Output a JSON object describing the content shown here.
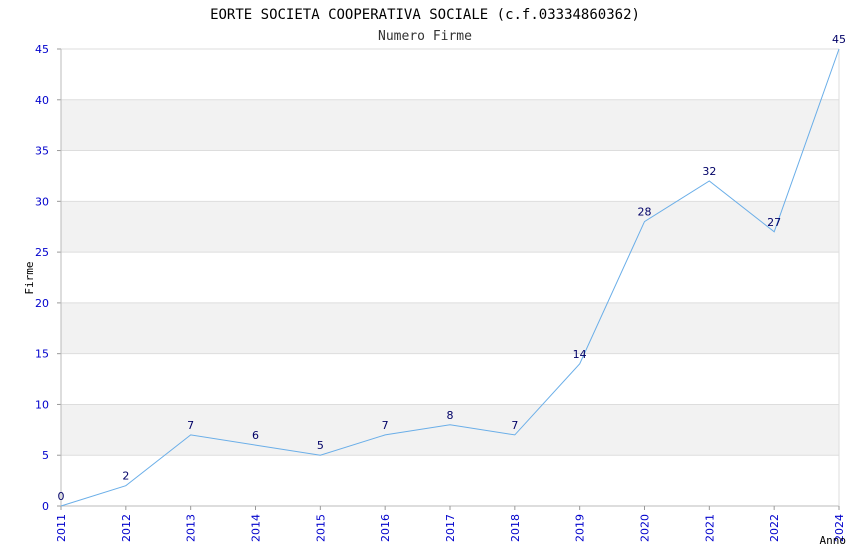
{
  "chart_data": {
    "type": "line",
    "title": "EORTE SOCIETA COOPERATIVA SOCIALE (c.f.03334860362)",
    "subtitle": "Numero Firme",
    "xlabel": "Anno",
    "ylabel": "Firme",
    "x": [
      "2011",
      "2012",
      "2013",
      "2014",
      "2015",
      "2016",
      "2017",
      "2018",
      "2019",
      "2020",
      "2021",
      "2022",
      "2024"
    ],
    "values": [
      0,
      2,
      7,
      6,
      5,
      7,
      8,
      7,
      14,
      28,
      32,
      27,
      45
    ],
    "ylim": [
      0,
      45
    ],
    "yticks": [
      0,
      5,
      10,
      15,
      20,
      25,
      30,
      35,
      40,
      45
    ],
    "grid": true,
    "colors": {
      "line": "#6aaee8",
      "band": "#f2f2f2",
      "grid": "#dddddd",
      "tick_text": "#0000cc",
      "data_label": "#000066"
    }
  }
}
